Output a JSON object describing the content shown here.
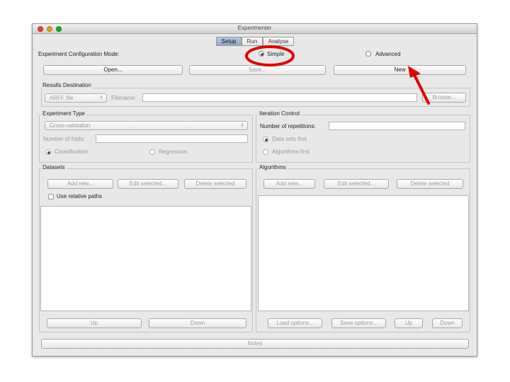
{
  "window": {
    "title": "Experimenter"
  },
  "tabs": [
    "Setup",
    "Run",
    "Analyse"
  ],
  "config": {
    "mode_label": "Experiment Configuration Mode:",
    "simple": "Simple",
    "advanced": "Advanced"
  },
  "top_buttons": {
    "open": "Open...",
    "save": "Save...",
    "new": "New"
  },
  "results": {
    "title": "Results Destination",
    "type": "ARFF file",
    "filename_label": "Filename:",
    "filename_value": "",
    "browse": "Browse..."
  },
  "experiment_type": {
    "title": "Experiment Type",
    "method": "Cross-validation",
    "folds_label": "Number of folds:",
    "folds_value": "",
    "classification": "Classification",
    "regression": "Regression"
  },
  "iteration": {
    "title": "Iteration Control",
    "reps_label": "Number of repetitions:",
    "reps_value": "",
    "data_first": "Data sets first",
    "algo_first": "Algorithms first"
  },
  "datasets": {
    "title": "Datasets",
    "add": "Add new...",
    "edit": "Edit selected...",
    "delete": "Delete selected",
    "relative": "Use relative paths",
    "up": "Up",
    "down": "Down"
  },
  "algorithms": {
    "title": "Algorithms",
    "add": "Add new...",
    "edit": "Edit selected...",
    "delete": "Delete selected",
    "load": "Load options...",
    "save": "Save options...",
    "up": "Up",
    "down": "Down"
  },
  "notes": "Notes",
  "colors": {
    "annotation": "#e00000",
    "tab_active": "#8ea6c8"
  }
}
